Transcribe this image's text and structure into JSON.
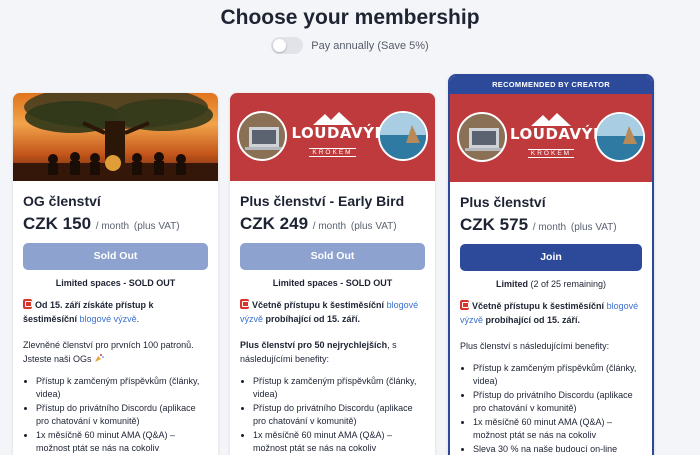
{
  "page": {
    "title": "Choose your membership",
    "toggle_label": "Pay annually (Save 5%)"
  },
  "cards": [
    {
      "name": "OG členství",
      "price": "CZK 150",
      "per": "/ month",
      "vat": "(plus VAT)",
      "button": "Sold Out",
      "limit": "Limited spaces - SOLD OUT",
      "note_prefix": "Od 15. září získáte přístup k",
      "note_bold": "šestiměsíční",
      "note_link": "blogové výzvě",
      "note_suffix": ".",
      "desc": "Zlevněné členství pro prvních 100 patronů. Jsteste naši OGs",
      "features": [
        "Přístup k zamčeným příspěvkům (články, videa)",
        "Přístup do privátního Discordu (aplikace pro chatování v komunitě)",
        "1x měsíčně 60 minut AMA (Q&A) – možnost ptát se nás na cokoliv"
      ]
    },
    {
      "name": "Plus členství - Early Bird",
      "price": "CZK 249",
      "per": "/ month",
      "vat": "(plus VAT)",
      "button": "Sold Out",
      "limit": "Limited spaces - SOLD OUT",
      "note_bold": "Včetně přístupu k šestiměsíční",
      "note_link": "blogové výzvě",
      "note_suffix": "probíhající od 15. září.",
      "desc_bold": "Plus členství pro 50 nejrychlejších",
      "desc_rest": ", s následujícími benefity:",
      "features": [
        "Přístup k zamčeným příspěvkům (články, videa)",
        "Přístup do privátního Discordu (aplikace pro chatování v komunitě)",
        "1x měsíčně 60 minut AMA (Q&A) – možnost ptát se nás na cokoliv"
      ]
    },
    {
      "ribbon": "RECOMMENDED BY CREATOR",
      "name": "Plus členství",
      "price": "CZK 575",
      "per": "/ month",
      "vat": "(plus VAT)",
      "button": "Join",
      "limit": "Limited",
      "limit_rest": "(2 of 25 remaining)",
      "note_bold": "Včetně přístupu k šestiměsíční",
      "note_link": "blogové výzvě",
      "note_suffix": "probíhající od 15. září.",
      "desc": "Plus členství s následujícími benefity:",
      "features": [
        "Přístup k zamčeným příspěvkům (články, videa)",
        "Přístup do privátního Discordu (aplikace pro chatování v komunitě)",
        "1x měsíčně 60 minut AMA (Q&A) – možnost ptát se nás na cokoliv",
        "Sleva 30 % na naše budoucí on-line"
      ]
    }
  ],
  "brand": {
    "logo_main": "LOUDAVÝM",
    "logo_sub": "KROKEM"
  },
  "colors": {
    "accent": "#2d4a9a",
    "sold_out": "#8da2cf",
    "banner_red": "#bf3a3d",
    "link": "#3a6fcf"
  },
  "icons": [
    "badge-icon",
    "party-popper-icon",
    "mountain-logo-icon"
  ]
}
